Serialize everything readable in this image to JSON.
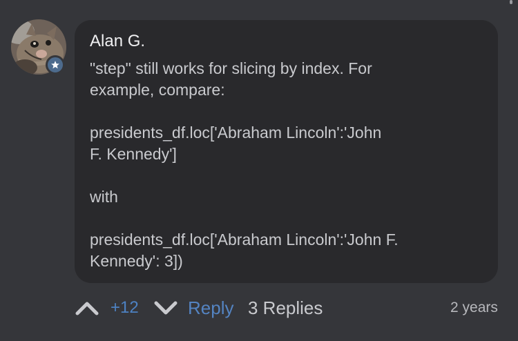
{
  "comment": {
    "author": "Alan G.",
    "text": "\"step\" still works for slicing by index. For\nexample, compare:\n\npresidents_df.loc['Abraham Lincoln':'John\nF. Kennedy']\n\nwith\n\npresidents_df.loc['Abraham Lincoln':'John F.\nKennedy': 3])",
    "avatar_icon": "cat-photo-avatar",
    "badge_icon": "star-badge-icon"
  },
  "actions": {
    "upvote_icon": "chevron-up-icon",
    "vote_count": "+12",
    "downvote_icon": "chevron-down-icon",
    "reply_label": "Reply",
    "replies_label": "3 Replies",
    "timestamp": "2 years"
  },
  "colors": {
    "background": "#35363a",
    "bubble": "#29292c",
    "accent": "#5484c2",
    "badge": "#4d6b8d"
  }
}
